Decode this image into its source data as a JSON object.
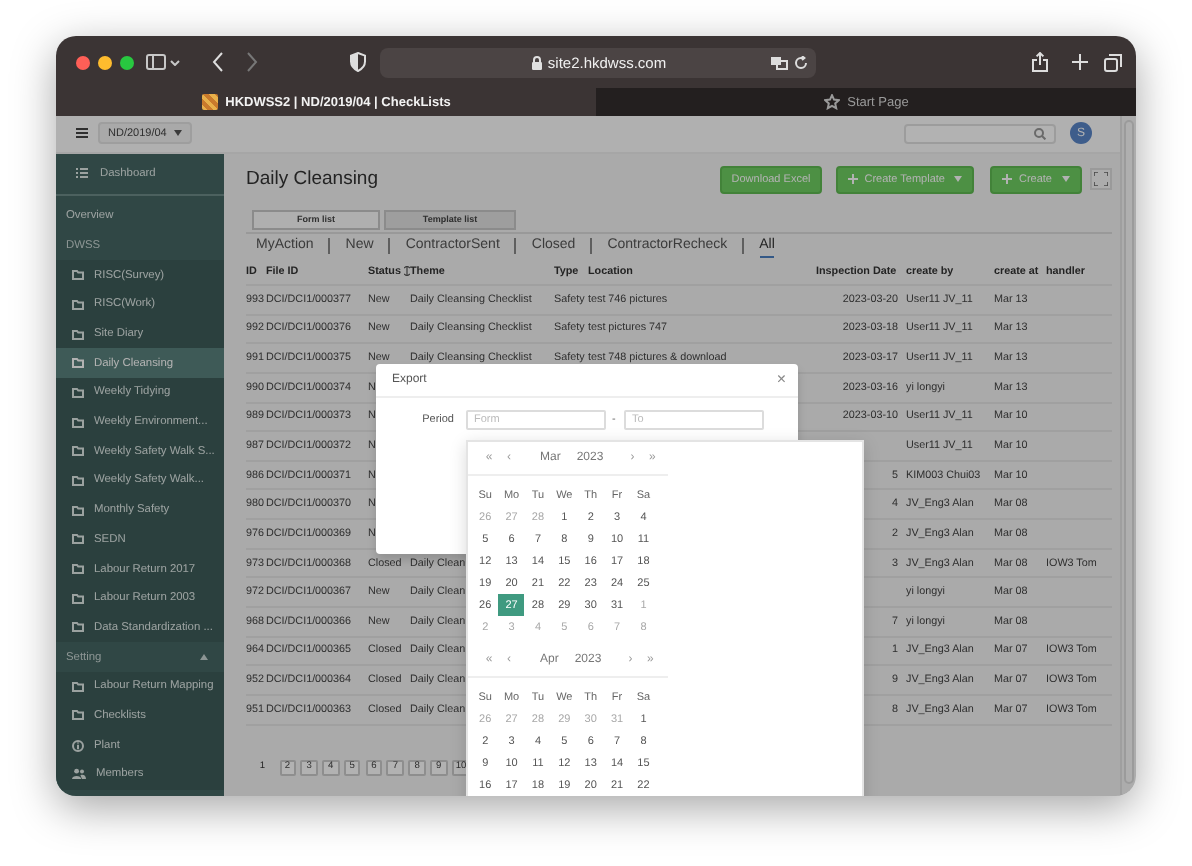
{
  "browser": {
    "url": "site2.hkdwss.com",
    "tabs": [
      {
        "title": "HKDWSS2 | ND/2019/04 | CheckLists",
        "kind": "site",
        "selected": true
      },
      {
        "title": "Start Page",
        "kind": "start",
        "selected": false
      }
    ]
  },
  "header": {
    "project": "ND/2019/04",
    "avatar": "S"
  },
  "sidebar": {
    "dashboard": "Dashboard",
    "entries": [
      {
        "label": "Overview",
        "kind": "link"
      },
      {
        "label": "DWSS",
        "kind": "group",
        "children": [
          {
            "label": "RISC(Survey)",
            "kind": "folder",
            "selected": false
          },
          {
            "label": "RISC(Work)",
            "kind": "folder",
            "selected": false
          },
          {
            "label": "Site Diary",
            "kind": "folder",
            "selected": false
          },
          {
            "label": "Daily Cleansing",
            "kind": "folder",
            "selected": true
          },
          {
            "label": "Weekly Tidying",
            "kind": "folder",
            "selected": false
          },
          {
            "label": "Weekly Environment...",
            "kind": "folder",
            "selected": false
          },
          {
            "label": "Weekly Safety Walk S...",
            "kind": "folder",
            "selected": false
          },
          {
            "label": "Weekly Safety Walk...",
            "kind": "folder",
            "selected": false
          },
          {
            "label": "Monthly Safety",
            "kind": "folder",
            "selected": false
          },
          {
            "label": "SEDN",
            "kind": "folder",
            "selected": false
          },
          {
            "label": "Labour Return 2017",
            "kind": "folder",
            "selected": false
          },
          {
            "label": "Labour Return 2003",
            "kind": "folder",
            "selected": false
          },
          {
            "label": "Data Standardization ...",
            "kind": "folder",
            "selected": false
          }
        ]
      },
      {
        "label": "Setting",
        "kind": "group",
        "expanded": true,
        "children": [
          {
            "label": "Labour Return Mapping",
            "kind": "folder",
            "selected": false
          },
          {
            "label": "Checklists",
            "kind": "folder",
            "selected": false
          },
          {
            "label": "Plant",
            "kind": "info",
            "selected": false
          },
          {
            "label": "Members",
            "kind": "people",
            "selected": false
          }
        ]
      }
    ]
  },
  "page": {
    "title": "Daily Cleansing",
    "actions": [
      {
        "label": "Download Excel",
        "kind": "plain"
      },
      {
        "label": "Create Template",
        "kind": "dropdown"
      },
      {
        "label": "Create",
        "kind": "dropdown"
      }
    ],
    "view_tabs": [
      {
        "label": "Form list",
        "selected": true
      },
      {
        "label": "Template list",
        "selected": false
      }
    ],
    "filters": [
      {
        "label": "MyAction",
        "selected": false
      },
      {
        "label": "New",
        "selected": false
      },
      {
        "label": "ContractorSent",
        "selected": false
      },
      {
        "label": "Closed",
        "selected": false
      },
      {
        "label": "ContractorRecheck",
        "selected": false
      },
      {
        "label": "All",
        "selected": true
      }
    ],
    "table": {
      "columns": [
        {
          "label": "ID",
          "sortable": false
        },
        {
          "label": "File ID",
          "sortable": false
        },
        {
          "label": "Status",
          "sortable": true
        },
        {
          "label": "Theme",
          "sortable": false
        },
        {
          "label": "Type",
          "sortable": false
        },
        {
          "label": "Location",
          "sortable": false
        },
        {
          "label": "Inspection Date",
          "sortable": false
        },
        {
          "label": "create by",
          "sortable": false
        },
        {
          "label": "create at",
          "sortable": false
        },
        {
          "label": "handler",
          "sortable": false
        }
      ],
      "rows": [
        {
          "id": "993",
          "file_id": "DCI/DCI1/000377",
          "status": "New",
          "theme": "Daily Cleansing Checklist",
          "type": "Safety",
          "location": "test 746 pictures",
          "inspection_date": "2023-03-20",
          "create_by": "User11 JV_11",
          "create_at": "Mar 13"
        },
        {
          "id": "992",
          "file_id": "DCI/DCI1/000376",
          "status": "New",
          "theme": "Daily Cleansing Checklist",
          "type": "Safety",
          "location": "test pictures 747",
          "inspection_date": "2023-03-18",
          "create_by": "User11 JV_11",
          "create_at": "Mar 13"
        },
        {
          "id": "991",
          "file_id": "DCI/DCI1/000375",
          "status": "New",
          "theme": "Daily Cleansing Checklist",
          "type": "Safety",
          "location": "test 748 pictures & download",
          "inspection_date": "2023-03-17",
          "create_by": "User11 JV_11",
          "create_at": "Mar 13"
        },
        {
          "id": "990",
          "file_id": "DCI/DCI1/000374",
          "status": "N",
          "inspection_date": "2023-03-16",
          "create_by": "yi longyi",
          "create_at": "Mar 13"
        },
        {
          "id": "989",
          "file_id": "DCI/DCI1/000373",
          "status": "N",
          "inspection_date": "2023-03-10",
          "create_by": "User11 JV_11",
          "create_at": "Mar 10"
        },
        {
          "id": "987",
          "file_id": "DCI/DCI1/000372",
          "status": "N",
          "create_by": "User11 JV_11",
          "create_at": "Mar 10"
        },
        {
          "id": "986",
          "file_id": "DCI/DCI1/000371",
          "status": "N",
          "inspection_date": "5",
          "create_by": "KIM003 Chui03",
          "create_at": "Mar 10"
        },
        {
          "id": "980",
          "file_id": "DCI/DCI1/000370",
          "status": "N",
          "inspection_date": "4",
          "create_by": "JV_Eng3 Alan",
          "create_at": "Mar 08"
        },
        {
          "id": "976",
          "file_id": "DCI/DCI1/000369",
          "status": "N",
          "inspection_date": "2",
          "create_by": "JV_Eng3 Alan",
          "create_at": "Mar 08"
        },
        {
          "id": "973",
          "file_id": "DCI/DCI1/000368",
          "status": "Closed",
          "theme": "Daily Clean",
          "inspection_date": "3",
          "create_by": "JV_Eng3 Alan",
          "create_at": "Mar 08",
          "handler": "IOW3 Tom"
        },
        {
          "id": "972",
          "file_id": "DCI/DCI1/000367",
          "status": "New",
          "theme": "Daily Clean",
          "create_by": "yi longyi",
          "create_at": "Mar 08"
        },
        {
          "id": "968",
          "file_id": "DCI/DCI1/000366",
          "status": "New",
          "theme": "Daily Clean",
          "inspection_date": "7",
          "create_by": "yi longyi",
          "create_at": "Mar 08"
        },
        {
          "id": "964",
          "file_id": "DCI/DCI1/000365",
          "status": "Closed",
          "theme": "Daily Clean",
          "inspection_date": "1",
          "create_by": "JV_Eng3 Alan",
          "create_at": "Mar 07",
          "handler": "IOW3 Tom"
        },
        {
          "id": "952",
          "file_id": "DCI/DCI1/000364",
          "status": "Closed",
          "theme": "Daily Clean",
          "inspection_date": "9",
          "create_by": "JV_Eng3 Alan",
          "create_at": "Mar 07",
          "handler": "IOW3 Tom"
        },
        {
          "id": "951",
          "file_id": "DCI/DCI1/000363",
          "status": "Closed",
          "theme": "Daily Clean",
          "inspection_date": "8",
          "create_by": "JV_Eng3 Alan",
          "create_at": "Mar 07",
          "handler": "IOW3 Tom"
        }
      ]
    },
    "pagination": [
      {
        "label": "1",
        "selected": true
      },
      {
        "label": "2",
        "selected": false
      },
      {
        "label": "3",
        "selected": false
      },
      {
        "label": "4",
        "selected": false
      },
      {
        "label": "5",
        "selected": false
      },
      {
        "label": "6",
        "selected": false
      },
      {
        "label": "7",
        "selected": false
      },
      {
        "label": "8",
        "selected": false
      },
      {
        "label": "9",
        "selected": false
      },
      {
        "label": "10",
        "selected": false
      }
    ]
  },
  "dialog": {
    "title": "Export",
    "close": "×",
    "period_label": "Period",
    "from": {
      "placeholder": "Form"
    },
    "separator": "-",
    "to": {
      "placeholder": "To"
    }
  },
  "date_picker": {
    "months": [
      {
        "prev_year": "«",
        "prev": "‹",
        "month": "Mar",
        "year": "2023",
        "next": "›",
        "next_year": "»",
        "weekdays": [
          "Su",
          "Mo",
          "Tu",
          "We",
          "Th",
          "Fr",
          "Sa"
        ],
        "weeks": [
          [
            {
              "label": "26",
              "muted": true,
              "selected": false
            },
            {
              "label": "27",
              "muted": true,
              "selected": false
            },
            {
              "label": "28",
              "muted": true,
              "selected": false
            },
            {
              "label": "1",
              "muted": false,
              "selected": false
            },
            {
              "label": "2",
              "muted": false,
              "selected": false
            },
            {
              "label": "3",
              "muted": false,
              "selected": false
            },
            {
              "label": "4",
              "muted": false,
              "selected": false
            }
          ],
          [
            {
              "label": "5",
              "muted": false,
              "selected": false
            },
            {
              "label": "6",
              "muted": false,
              "selected": false
            },
            {
              "label": "7",
              "muted": false,
              "selected": false
            },
            {
              "label": "8",
              "muted": false,
              "selected": false
            },
            {
              "label": "9",
              "muted": false,
              "selected": false
            },
            {
              "label": "10",
              "muted": false,
              "selected": false
            },
            {
              "label": "11",
              "muted": false,
              "selected": false
            }
          ],
          [
            {
              "label": "12",
              "muted": false,
              "selected": false
            },
            {
              "label": "13",
              "muted": false,
              "selected": false
            },
            {
              "label": "14",
              "muted": false,
              "selected": false
            },
            {
              "label": "15",
              "muted": false,
              "selected": false
            },
            {
              "label": "16",
              "muted": false,
              "selected": false
            },
            {
              "label": "17",
              "muted": false,
              "selected": false
            },
            {
              "label": "18",
              "muted": false,
              "selected": false
            }
          ],
          [
            {
              "label": "19",
              "muted": false,
              "selected": false
            },
            {
              "label": "20",
              "muted": false,
              "selected": false
            },
            {
              "label": "21",
              "muted": false,
              "selected": false
            },
            {
              "label": "22",
              "muted": false,
              "selected": false
            },
            {
              "label": "23",
              "muted": false,
              "selected": false
            },
            {
              "label": "24",
              "muted": false,
              "selected": false
            },
            {
              "label": "25",
              "muted": false,
              "selected": false
            }
          ],
          [
            {
              "label": "26",
              "muted": false,
              "selected": false
            },
            {
              "label": "27",
              "muted": false,
              "selected": true
            },
            {
              "label": "28",
              "muted": false,
              "selected": false
            },
            {
              "label": "29",
              "muted": false,
              "selected": false
            },
            {
              "label": "30",
              "muted": false,
              "selected": false
            },
            {
              "label": "31",
              "muted": false,
              "selected": false
            },
            {
              "label": "1",
              "muted": true,
              "selected": false
            }
          ],
          [
            {
              "label": "2",
              "muted": true,
              "selected": false
            },
            {
              "label": "3",
              "muted": true,
              "selected": false
            },
            {
              "label": "4",
              "muted": true,
              "selected": false
            },
            {
              "label": "5",
              "muted": true,
              "selected": false
            },
            {
              "label": "6",
              "muted": true,
              "selected": false
            },
            {
              "label": "7",
              "muted": true,
              "selected": false
            },
            {
              "label": "8",
              "muted": true,
              "selected": false
            }
          ]
        ]
      },
      {
        "prev_year": "«",
        "prev": "‹",
        "month": "Apr",
        "year": "2023",
        "next": "›",
        "next_year": "»",
        "weekdays": [
          "Su",
          "Mo",
          "Tu",
          "We",
          "Th",
          "Fr",
          "Sa"
        ],
        "weeks": [
          [
            {
              "label": "26",
              "muted": true,
              "selected": false
            },
            {
              "label": "27",
              "muted": true,
              "selected": false
            },
            {
              "label": "28",
              "muted": true,
              "selected": false
            },
            {
              "label": "29",
              "muted": true,
              "selected": false
            },
            {
              "label": "30",
              "muted": true,
              "selected": false
            },
            {
              "label": "31",
              "muted": true,
              "selected": false
            },
            {
              "label": "1",
              "muted": false,
              "selected": false
            }
          ],
          [
            {
              "label": "2",
              "muted": false,
              "selected": false
            },
            {
              "label": "3",
              "muted": false,
              "selected": false
            },
            {
              "label": "4",
              "muted": false,
              "selected": false
            },
            {
              "label": "5",
              "muted": false,
              "selected": false
            },
            {
              "label": "6",
              "muted": false,
              "selected": false
            },
            {
              "label": "7",
              "muted": false,
              "selected": false
            },
            {
              "label": "8",
              "muted": false,
              "selected": false
            }
          ],
          [
            {
              "label": "9",
              "muted": false,
              "selected": false
            },
            {
              "label": "10",
              "muted": false,
              "selected": false
            },
            {
              "label": "11",
              "muted": false,
              "selected": false
            },
            {
              "label": "12",
              "muted": false,
              "selected": false
            },
            {
              "label": "13",
              "muted": false,
              "selected": false
            },
            {
              "label": "14",
              "muted": false,
              "selected": false
            },
            {
              "label": "15",
              "muted": false,
              "selected": false
            }
          ],
          [
            {
              "label": "16",
              "muted": false,
              "selected": false
            },
            {
              "label": "17",
              "muted": false,
              "selected": false
            },
            {
              "label": "18",
              "muted": false,
              "selected": false
            },
            {
              "label": "19",
              "muted": false,
              "selected": false
            },
            {
              "label": "20",
              "muted": false,
              "selected": false
            },
            {
              "label": "21",
              "muted": false,
              "selected": false
            },
            {
              "label": "22",
              "muted": false,
              "selected": false
            }
          ]
        ]
      }
    ]
  }
}
